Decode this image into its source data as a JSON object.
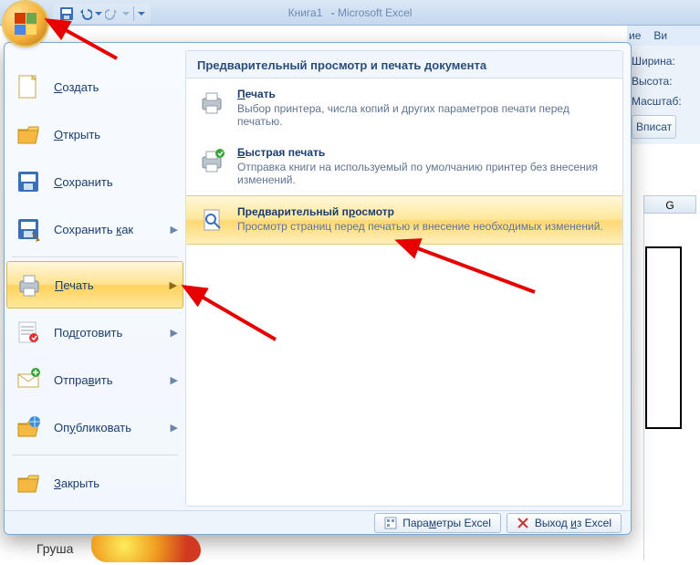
{
  "titlebar": {
    "doc": "Книга1",
    "sep": "-",
    "app": "Microsoft Excel"
  },
  "ribbon_right": {
    "tabs": [
      "ие",
      "Ви"
    ],
    "rows": [
      "Ширина:",
      "Высота:",
      "Масштаб:"
    ],
    "btn": "Вписат"
  },
  "col_g_label": "G",
  "menu": {
    "left": [
      {
        "label": "Создать",
        "u": [
          0
        ],
        "arrow": false,
        "icon": "new"
      },
      {
        "label": "Открыть",
        "u": [
          0
        ],
        "arrow": false,
        "icon": "open"
      },
      {
        "label": "Сохранить",
        "u": [
          0
        ],
        "arrow": false,
        "icon": "save"
      },
      {
        "label": "Сохранить как",
        "u": [
          10
        ],
        "arrow": true,
        "icon": "saveas"
      },
      {
        "label": "Печать",
        "u": [
          0
        ],
        "arrow": true,
        "icon": "print",
        "selected": true
      },
      {
        "label": "Подготовить",
        "u": [
          3
        ],
        "arrow": true,
        "icon": "prepare"
      },
      {
        "label": "Отправить",
        "u": [
          5
        ],
        "arrow": true,
        "icon": "send"
      },
      {
        "label": "Опубликовать",
        "u": [
          2
        ],
        "arrow": true,
        "icon": "publish"
      },
      {
        "label": "Закрыть",
        "u": [
          0
        ],
        "arrow": false,
        "icon": "close"
      }
    ],
    "panel_header": "Предварительный просмотр и печать документа",
    "subitems": [
      {
        "title": "Печать",
        "u": 0,
        "desc": "Выбор принтера, числа копий и других параметров печати перед печатью.",
        "icon": "printer"
      },
      {
        "title": "Быстрая печать",
        "u": 0,
        "desc": "Отправка книги на используемый по умолчанию принтер без внесения изменений.",
        "icon": "quickprint"
      },
      {
        "title": "Предварительный просмотр",
        "u": 17,
        "desc": "Просмотр страниц перед печатью и внесение необходимых изменений.",
        "icon": "preview",
        "highlight": true
      }
    ],
    "footer": {
      "options": "Параметры Excel",
      "options_u": 4,
      "exit": "Выход из Excel",
      "exit_u": 6
    }
  },
  "sheet_peek": {
    "cell": "Груша"
  }
}
